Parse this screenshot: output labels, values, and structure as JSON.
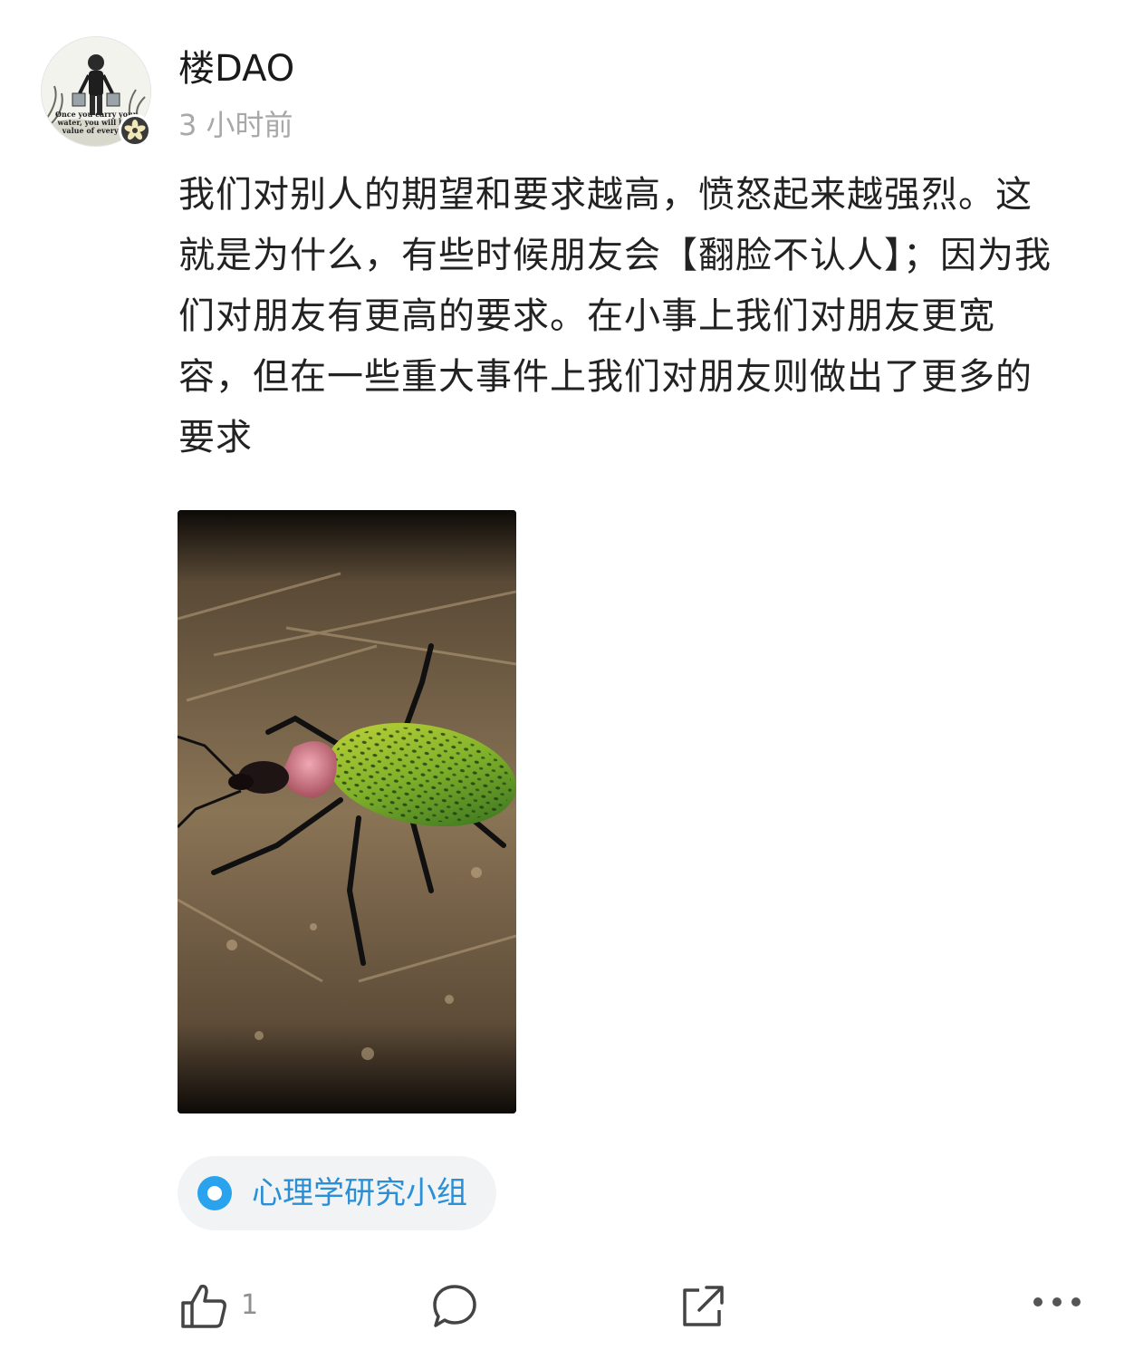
{
  "author": {
    "name": "楼DAO",
    "time": "3 小时前",
    "avatar_caption": "Once you carry your\nwater, you will lear\nvalue of every dr"
  },
  "post": {
    "text": "我们对别人的期望和要求越高，愤怒起来越强烈。这就是为什么，有些时候朋友会【翻脸不认人】；因为我们对朋友有更高的要求。在小事上我们对朋友更宽容，但在一些重大事件上我们对朋友则做出了更多的要求"
  },
  "group": {
    "label": "心理学研究小组",
    "color": "#2a8fd4"
  },
  "actions": {
    "like_count": "1",
    "icons": [
      "thumbs-up-icon",
      "comment-icon",
      "share-icon",
      "more-icon"
    ]
  }
}
